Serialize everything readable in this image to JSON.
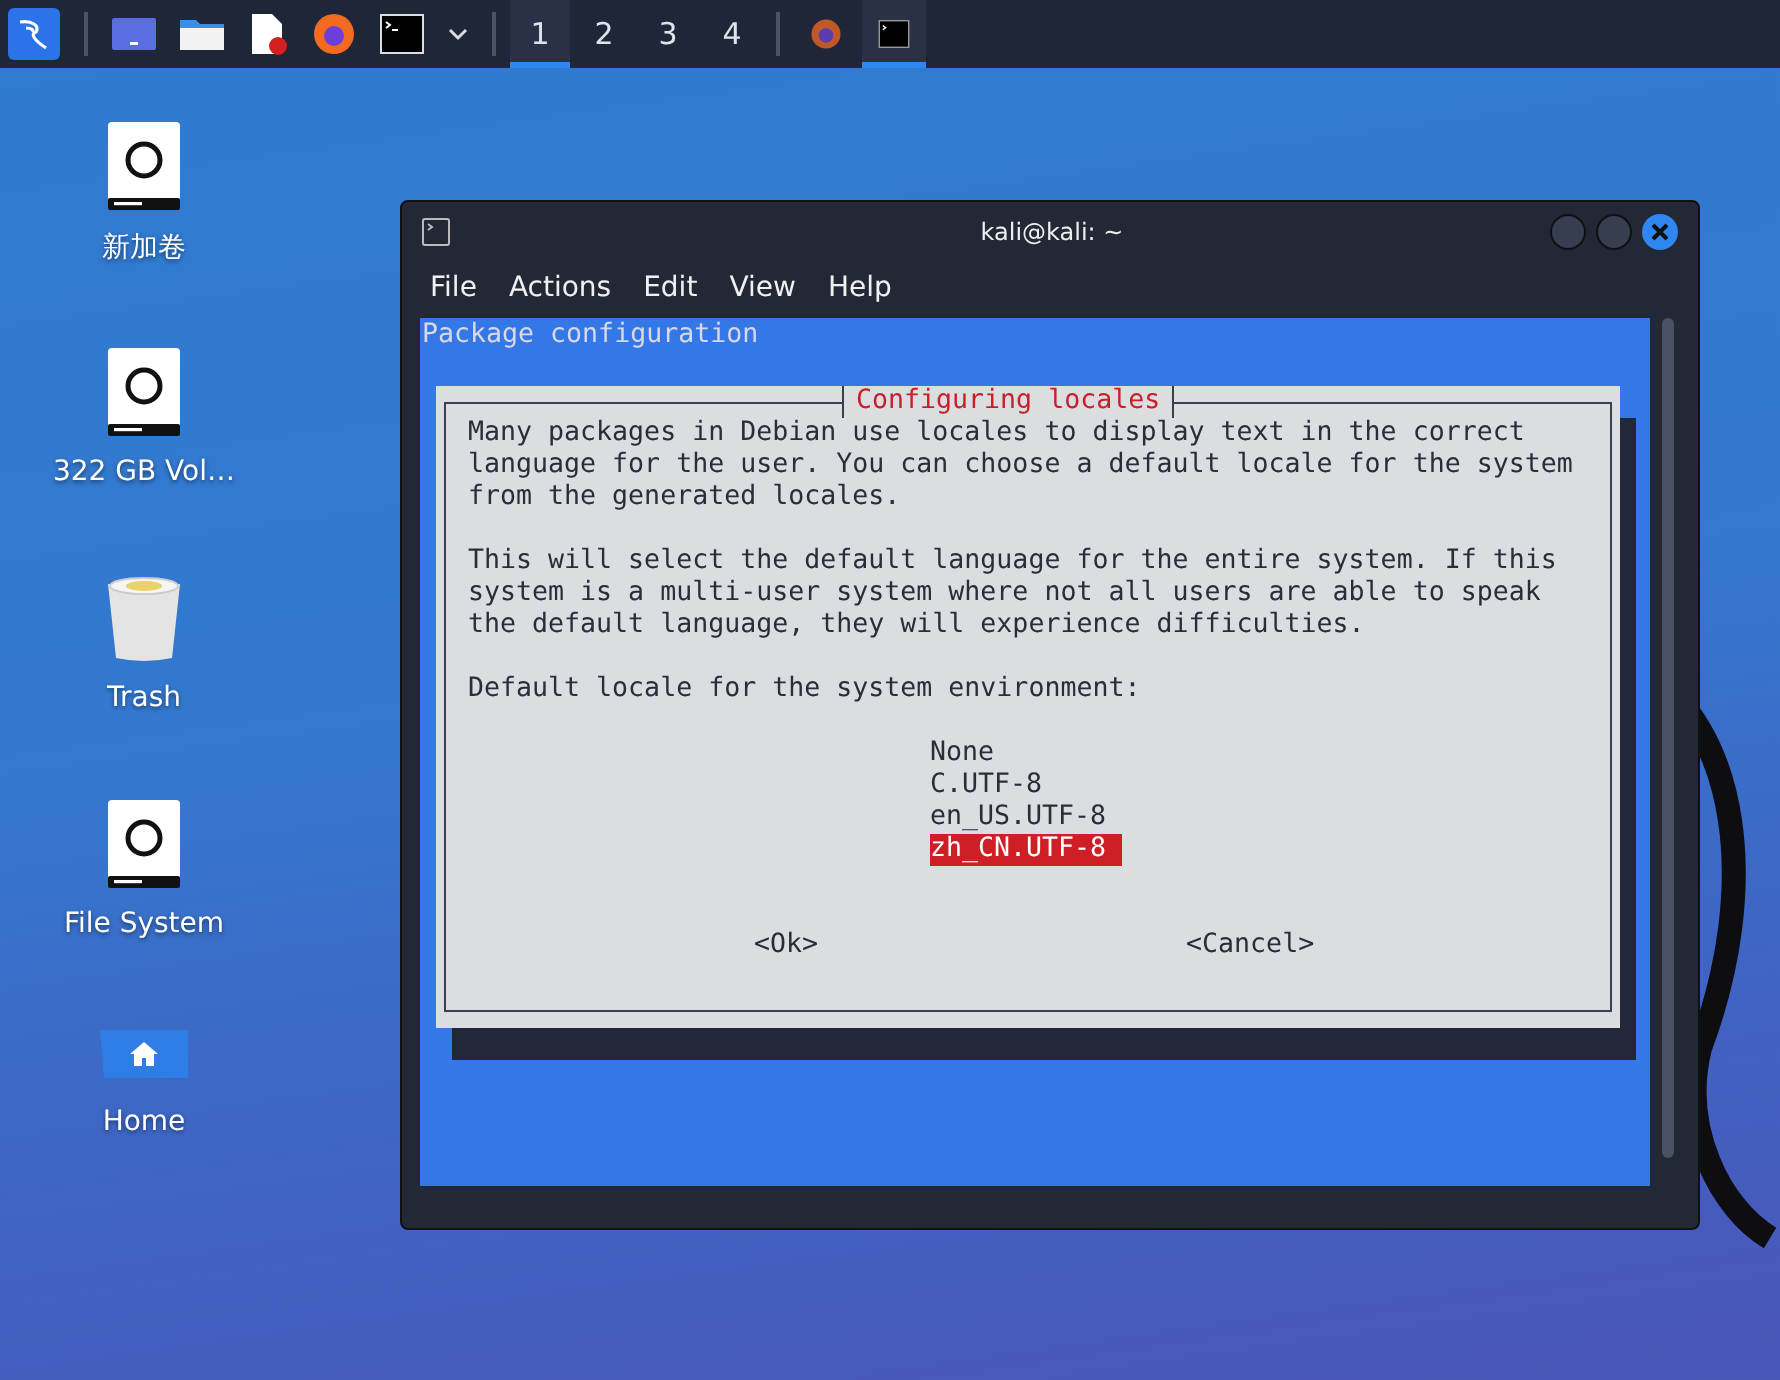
{
  "taskbar": {
    "launchers": [
      {
        "kind": "kali"
      },
      {
        "kind": "desktop"
      },
      {
        "kind": "folder"
      },
      {
        "kind": "editor"
      },
      {
        "kind": "firefox"
      },
      {
        "kind": "terminal"
      },
      {
        "kind": "dropdown"
      }
    ],
    "workspaces": [
      {
        "label": "1",
        "selected": true
      },
      {
        "label": "2",
        "selected": false
      },
      {
        "label": "3",
        "selected": false
      },
      {
        "label": "4",
        "selected": false
      }
    ],
    "tasks": [
      {
        "kind": "firefox",
        "selected": false
      },
      {
        "kind": "terminal",
        "selected": true
      }
    ]
  },
  "desktop_icons": [
    {
      "label": "新加卷",
      "kind": "drive"
    },
    {
      "label": "322 GB Vol…",
      "kind": "drive"
    },
    {
      "label": "Trash",
      "kind": "trash"
    },
    {
      "label": "File System",
      "kind": "drive"
    },
    {
      "label": "Home",
      "kind": "home"
    }
  ],
  "window": {
    "title": "kali@kali: ~",
    "menu": [
      "File",
      "Actions",
      "Edit",
      "View",
      "Help"
    ],
    "terminal": {
      "header": "Package configuration",
      "dialog": {
        "title": "Configuring locales",
        "paragraphs": [
          "Many packages in Debian use locales to display text in the correct\nlanguage for the user. You can choose a default locale for the system\nfrom the generated locales.",
          "This will select the default language for the entire system. If this\nsystem is a multi-user system where not all users are able to speak\nthe default language, they will experience difficulties.",
          "Default locale for the system environment:"
        ],
        "options": [
          {
            "label": "None",
            "selected": false
          },
          {
            "label": "C.UTF-8",
            "selected": false
          },
          {
            "label": "en_US.UTF-8",
            "selected": false
          },
          {
            "label": "zh_CN.UTF-8",
            "selected": true
          }
        ],
        "buttons": [
          "<Ok>",
          "<Cancel>"
        ]
      }
    }
  }
}
